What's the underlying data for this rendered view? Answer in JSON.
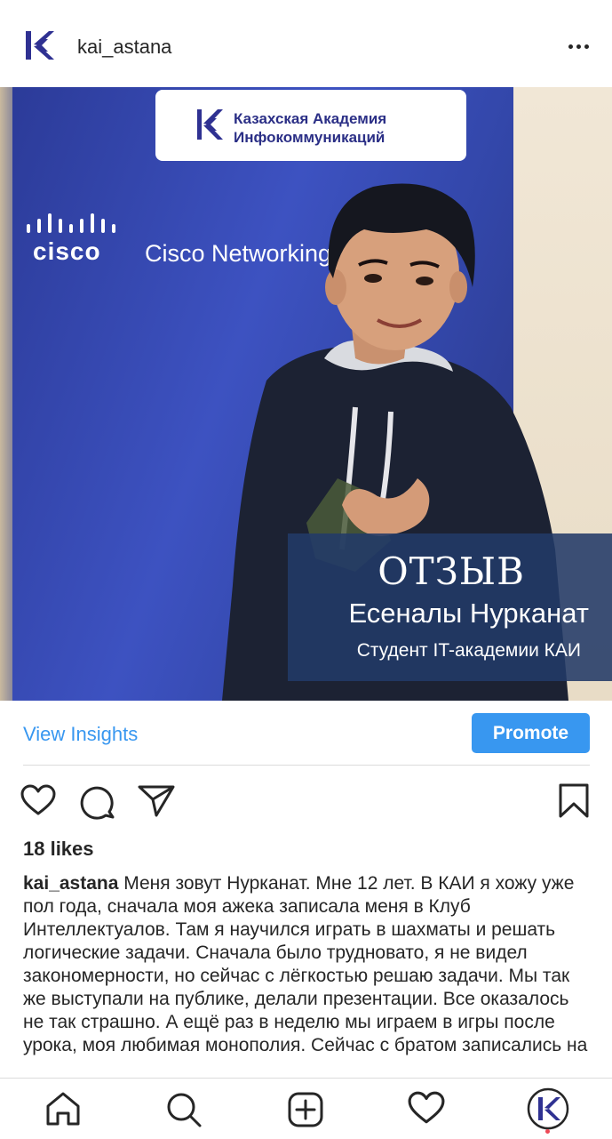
{
  "header": {
    "username": "kai_astana",
    "avatar_icon": "kai-logo-icon",
    "more_icon": "more-options-icon"
  },
  "photo": {
    "banner_logo_line1": "Казахская Академия",
    "banner_logo_line2": "Инфокоммуникаций",
    "cisco_word": "cisco",
    "cisco_line": "Cisco Networking Academy",
    "overlay_title": "ОТЗЫВ",
    "overlay_name": "Есеналы Нурканат",
    "overlay_subtitle": "Студент IT-академии КАИ"
  },
  "actions": {
    "view_insights": "View Insights",
    "promote": "Promote",
    "icons": [
      "heart-icon",
      "comment-icon",
      "share-icon",
      "bookmark-icon"
    ]
  },
  "likes": "18 likes",
  "caption": {
    "author": "kai_astana",
    "text": "Меня зовут Нурканат. Мне 12 лет. В КАИ я хожу уже пол года, сначала моя ажека записала меня в Клуб Интеллектуалов. Там я научился играть в шахматы и решать логические задачи. Сначала было трудновато, я не видел закономерности, но сейчас с лёгкостью решаю задачи. Мы так же выступали на публике, делали презентации. Все оказалось не так страшно. А ещё раз в неделю мы играем в игры после урока, моя любимая монополия. Сейчас с братом записались на"
  },
  "nav": {
    "items": [
      "home-icon",
      "search-icon",
      "new-post-icon",
      "activity-icon",
      "profile-icon"
    ]
  },
  "colors": {
    "accent": "#3897f0",
    "text": "#262626",
    "brand": "#2b2f86",
    "overlay": "#223a68"
  }
}
